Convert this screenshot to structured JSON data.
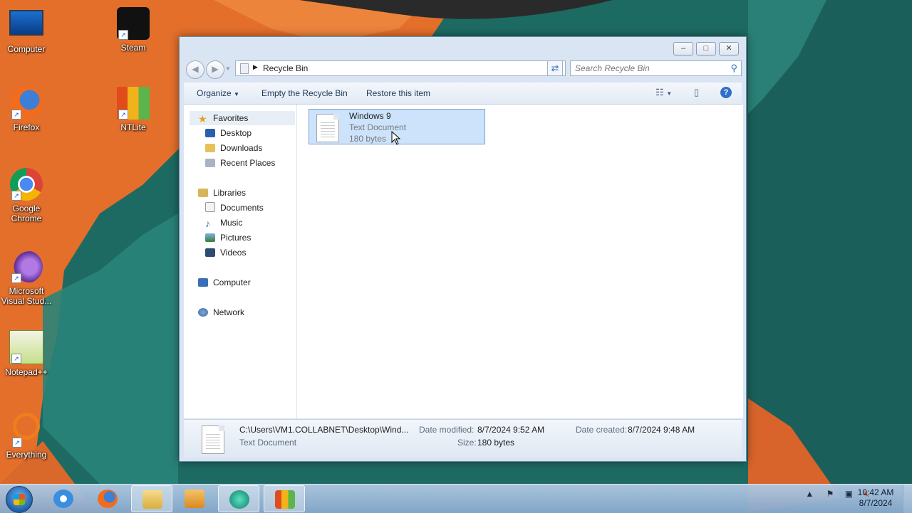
{
  "desktop": {
    "icons": [
      {
        "label": "Computer"
      },
      {
        "label": "Steam"
      },
      {
        "label": "Firefox"
      },
      {
        "label": "NTLite"
      },
      {
        "label": "Google Chrome"
      },
      {
        "label": "Microsoft Visual Stud..."
      },
      {
        "label": "Notepad++"
      },
      {
        "label": "Everything"
      }
    ]
  },
  "window": {
    "caption_buttons": {
      "minimize": "–",
      "maximize": "□",
      "close": "✕"
    },
    "address": {
      "path": "Recycle Bin"
    },
    "search": {
      "placeholder": "Search Recycle Bin"
    },
    "toolbar": {
      "organize": "Organize",
      "empty": "Empty the Recycle Bin",
      "restore": "Restore this item",
      "help": "?"
    },
    "nav": {
      "favorites": {
        "label": "Favorites",
        "items": [
          "Desktop",
          "Downloads",
          "Recent Places"
        ]
      },
      "libraries": {
        "label": "Libraries",
        "items": [
          "Documents",
          "Music",
          "Pictures",
          "Videos"
        ]
      },
      "computer": "Computer",
      "network": "Network"
    },
    "file": {
      "name": "Windows 9",
      "type": "Text Document",
      "size": "180 bytes"
    },
    "details": {
      "path": "C:\\Users\\VM1.COLLABNET\\Desktop\\Wind...",
      "type": "Text Document",
      "date_modified_label": "Date modified:",
      "date_modified": "8/7/2024 9:52 AM",
      "size_label": "Size:",
      "size": "180 bytes",
      "date_created_label": "Date created:",
      "date_created": "8/7/2024 9:48 AM"
    }
  },
  "taskbar": {
    "clock": {
      "time": "10:42 AM",
      "date": "8/7/2024"
    },
    "apps": [
      "internet-explorer",
      "firefox",
      "explorer",
      "media-player",
      "app",
      "ntlite"
    ]
  },
  "colors": {
    "accent": "#2f6fc9",
    "selection": "#cce3fb",
    "wallpaper_orange": "#e8742c",
    "wallpaper_teal": "#1f6b63"
  }
}
